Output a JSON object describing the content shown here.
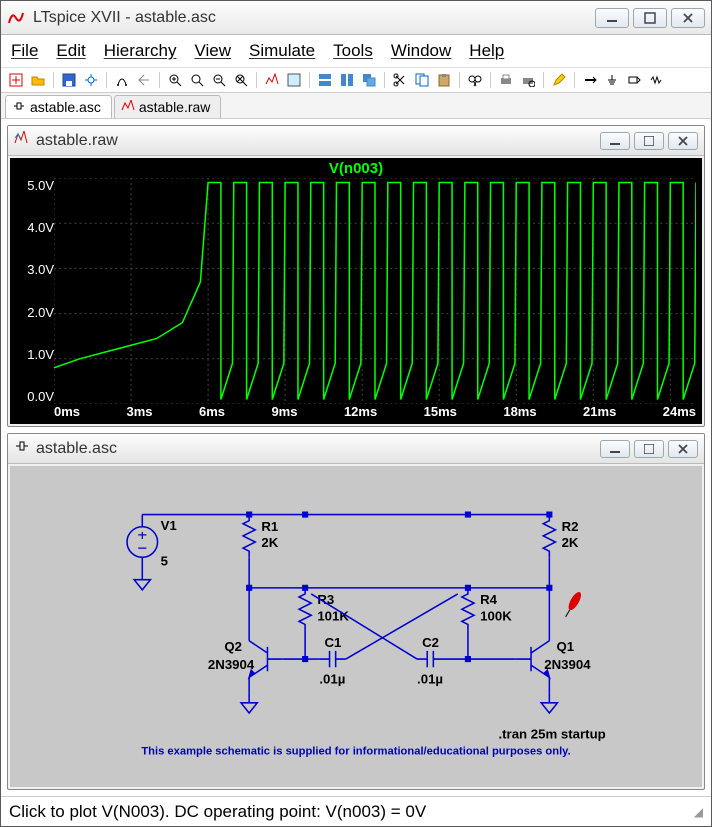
{
  "app": {
    "title": "LTspice XVII - astable.asc"
  },
  "menubar": {
    "items": [
      "File",
      "Edit",
      "Hierarchy",
      "View",
      "Simulate",
      "Tools",
      "Window",
      "Help"
    ]
  },
  "tabs": [
    {
      "label": "astable.asc",
      "active": true
    },
    {
      "label": "astable.raw",
      "active": false
    }
  ],
  "plot_window": {
    "title": "astable.raw"
  },
  "schematic_window": {
    "title": "astable.asc"
  },
  "chart_data": {
    "type": "line",
    "title": "V(n003)",
    "xlabel": "",
    "ylabel": "",
    "x_unit": "ms",
    "y_unit": "V",
    "xlim": [
      0,
      25
    ],
    "ylim": [
      0,
      5
    ],
    "x_ticks": [
      "0ms",
      "3ms",
      "6ms",
      "9ms",
      "12ms",
      "15ms",
      "18ms",
      "21ms",
      "24ms"
    ],
    "y_ticks": [
      "5.0V",
      "4.0V",
      "3.0V",
      "2.0V",
      "1.0V",
      "0.0V"
    ],
    "series": [
      {
        "name": "V(n003)",
        "color": "#00ff00",
        "description": "startup ramp then ~1ms period oscillation between ~0.1V and ~4.9V after ~6ms",
        "startup": [
          {
            "t": 0,
            "v": 0.8
          },
          {
            "t": 1,
            "v": 1.0
          },
          {
            "t": 2,
            "v": 1.15
          },
          {
            "t": 3,
            "v": 1.3
          },
          {
            "t": 4,
            "v": 1.45
          },
          {
            "t": 5,
            "v": 1.8
          },
          {
            "t": 5.7,
            "v": 2.7
          },
          {
            "t": 6,
            "v": 4.9
          }
        ],
        "oscillation": {
          "start_ms": 6,
          "period_ms": 1.0,
          "low_v": 0.1,
          "high_v": 4.9,
          "duty": 0.5,
          "end_ms": 25
        }
      }
    ]
  },
  "schematic": {
    "components": {
      "V1": {
        "name": "V1",
        "value": "5"
      },
      "R1": {
        "name": "R1",
        "value": "2K"
      },
      "R2": {
        "name": "R2",
        "value": "2K"
      },
      "R3": {
        "name": "R3",
        "value": "101K"
      },
      "R4": {
        "name": "R4",
        "value": "100K"
      },
      "C1": {
        "name": "C1",
        "value": ".01µ"
      },
      "C2": {
        "name": "C2",
        "value": ".01µ"
      },
      "Q1": {
        "name": "Q1",
        "value": "2N3904"
      },
      "Q2": {
        "name": "Q2",
        "value": "2N3904"
      }
    },
    "directive": ".tran 25m startup",
    "footer": "This example schematic is supplied for informational/educational purposes only."
  },
  "statusbar": {
    "text": "Click to plot V(N003).  DC operating point: V(n003) = 0V"
  },
  "window_controls": {
    "minimize": "—",
    "maximize": "▢",
    "close": "✕"
  }
}
